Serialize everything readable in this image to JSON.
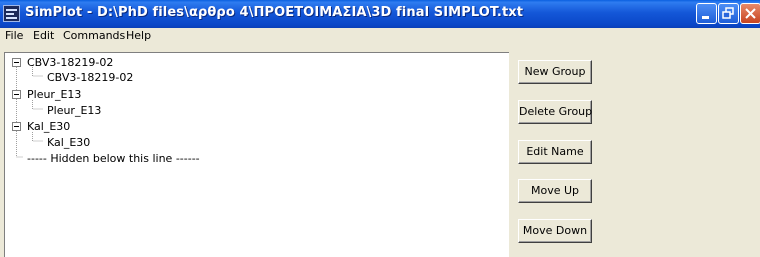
{
  "window": {
    "title": "SimPlot - D:\\PhD files\\αρθρο 4\\ΠΡΟΕΤΟΙΜΑΣΙΑ\\3D final SIMPLOT.txt",
    "controls": [
      "minimize-icon",
      "restore-icon",
      "close-icon"
    ]
  },
  "menu": {
    "file": "File",
    "edit": "Edit",
    "commands": "Commands",
    "help": "Help"
  },
  "tree": {
    "groups": [
      {
        "label": "CBV3-18219-02",
        "expanded": true,
        "children": [
          "CBV3-18219-02"
        ]
      },
      {
        "label": "Pleur_E13",
        "expanded": true,
        "children": [
          "Pleur_E13"
        ]
      },
      {
        "label": "Kal_E30",
        "expanded": true,
        "children": [
          "Kal_E30"
        ]
      }
    ],
    "hidden_separator": "----- Hidden below this line ------"
  },
  "buttons": {
    "new_group": "New Group",
    "delete_group": "Delete Group",
    "edit_name": "Edit Name",
    "move_up": "Move Up",
    "move_down": "Move Down"
  }
}
